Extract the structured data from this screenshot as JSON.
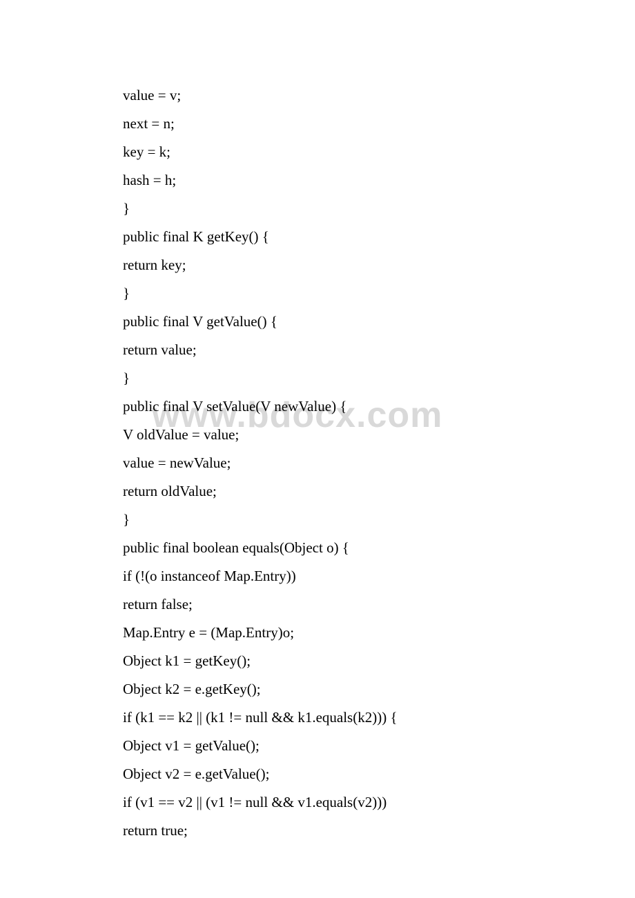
{
  "watermark": "www.bdocx.com",
  "lines": [
    "value = v;",
    "next = n;",
    "key = k;",
    "hash = h;",
    "}",
    "public final K getKey() {",
    "return key;",
    "}",
    "public final V getValue() {",
    "return value;",
    "}",
    "public final V setValue(V newValue) {",
    "V oldValue = value;",
    "value = newValue;",
    "return oldValue;",
    "}",
    "public final boolean equals(Object o) {",
    "if (!(o instanceof Map.Entry))",
    "return false;",
    "Map.Entry e = (Map.Entry)o;",
    "Object k1 = getKey();",
    "Object k2 = e.getKey();",
    "if (k1 == k2 || (k1 != null && k1.equals(k2))) {",
    "Object v1 = getValue();",
    "Object v2 = e.getValue();",
    "if (v1 == v2 || (v1 != null && v1.equals(v2)))",
    "return true;"
  ]
}
